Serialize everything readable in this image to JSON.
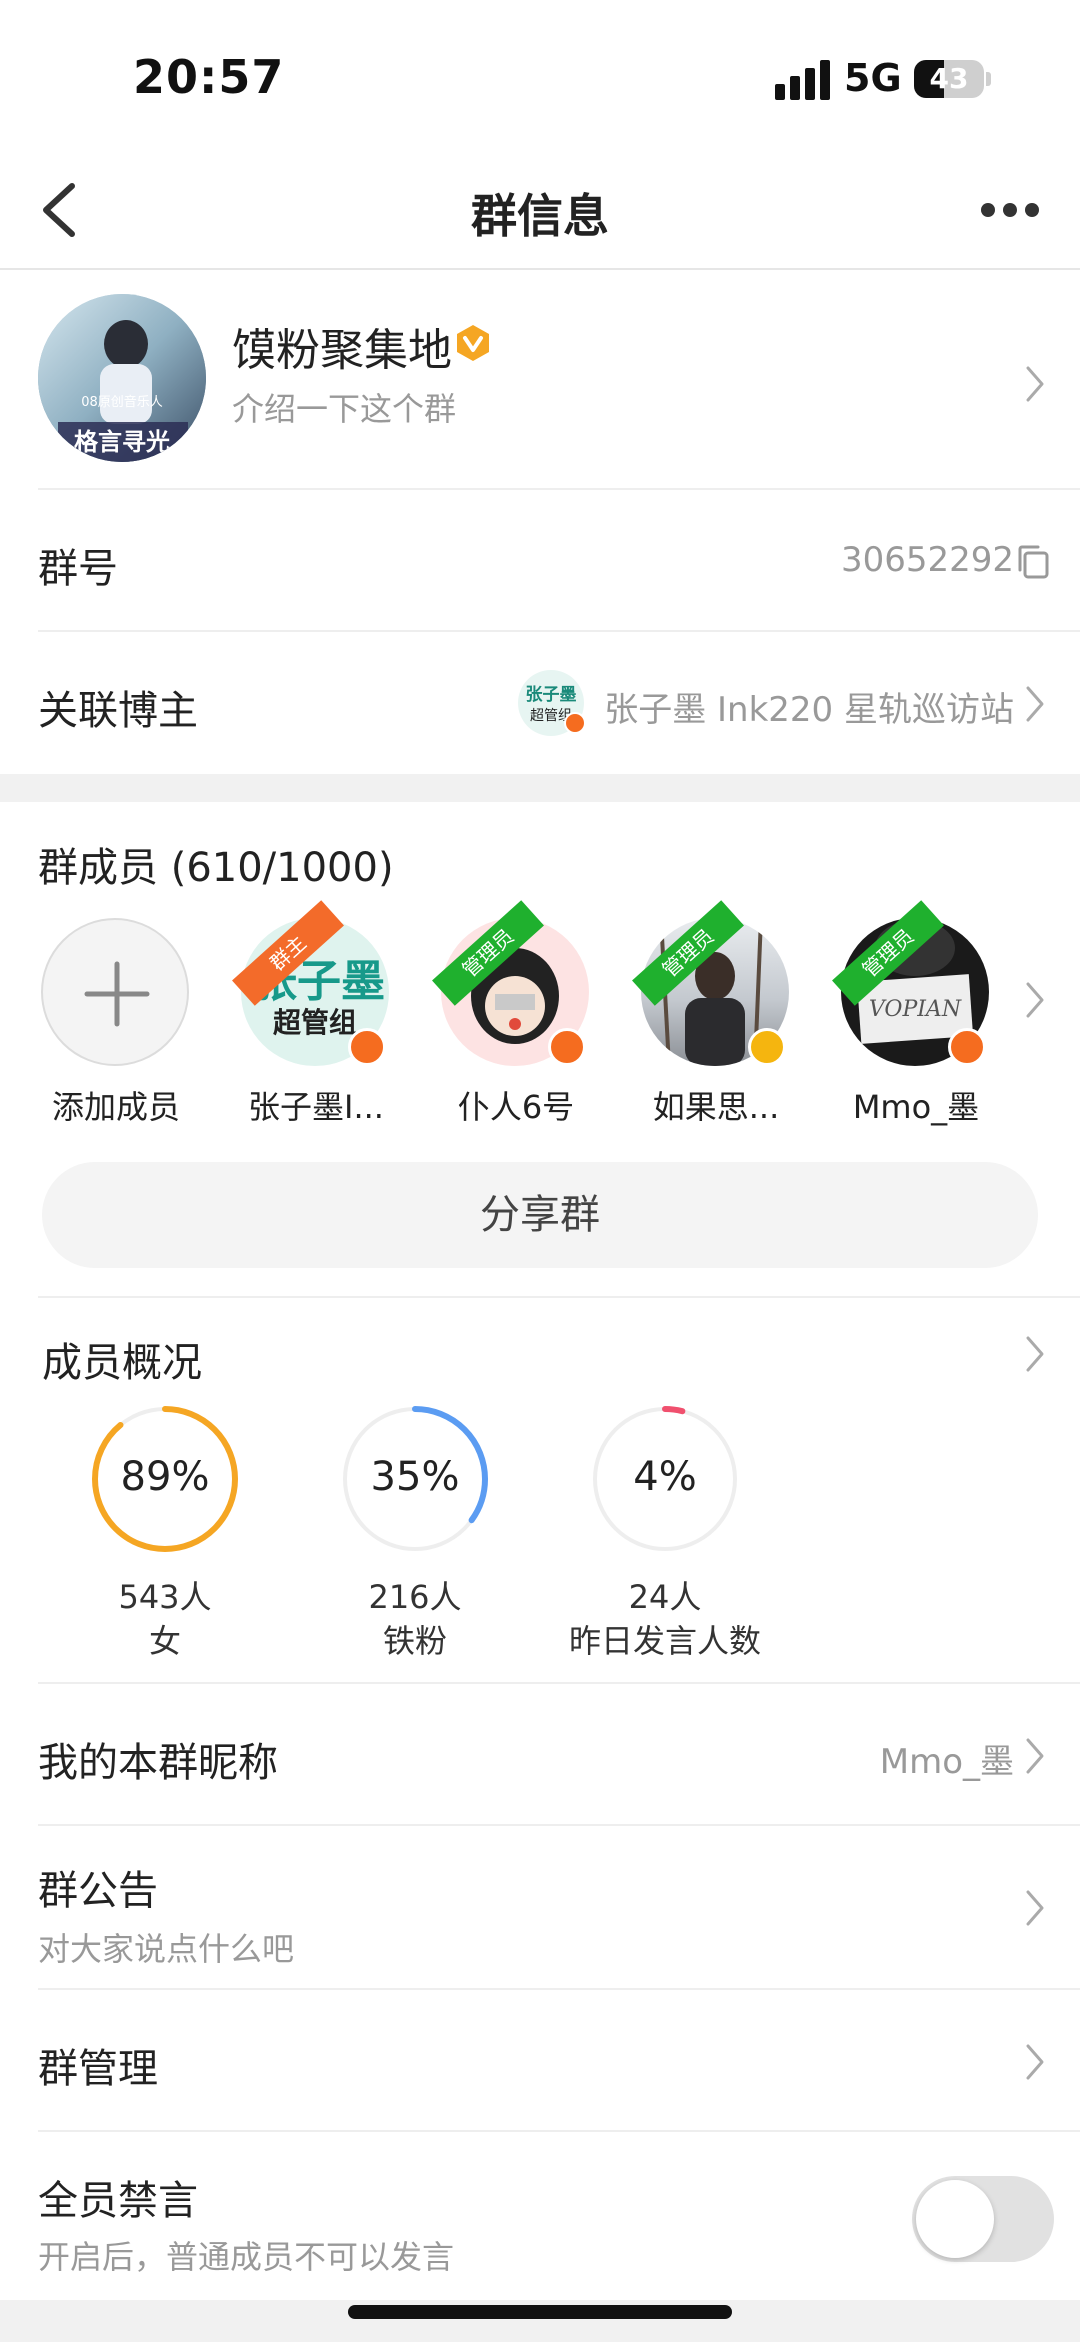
{
  "status_bar": {
    "time": "20:57",
    "network": "5G",
    "battery": "43",
    "battery_level_percent": 43
  },
  "nav": {
    "title": "群信息",
    "back_icon": "chevron-left-icon",
    "more_icon": "more-dots-icon"
  },
  "group": {
    "name": "馍粉聚集地",
    "intro": "介绍一下这个群",
    "avatar_text_1": "08原创音乐人",
    "avatar_text_2": "格言寻光"
  },
  "group_number": {
    "label": "群号",
    "value": "30652292",
    "copy_icon": "copy-icon"
  },
  "linked_blogger": {
    "label": "关联博主",
    "value": "张子墨 Ink220 星轨巡访站",
    "avatar_text_1": "张子墨",
    "avatar_text_2": "超管组"
  },
  "members": {
    "title": "群成员 (610/1000)",
    "items": [
      {
        "name": "添加成员",
        "type": "add"
      },
      {
        "name": "张子墨I...",
        "role": "群主",
        "role_color": "#f36b2a",
        "badge_color": "#f56c1f",
        "avatar_text_1": "张子墨",
        "avatar_text_2": "超管组"
      },
      {
        "name": "仆人6号",
        "role": "管理员",
        "role_color": "#1fb02e",
        "badge_color": "#f56c1f"
      },
      {
        "name": "如果思...",
        "role": "管理员",
        "role_color": "#1fb02e",
        "badge_color": "#f5b50f"
      },
      {
        "name": "Mmo_墨",
        "role": "管理员",
        "role_color": "#1fb02e",
        "badge_color": "#f56c1f",
        "avatar_text_1": "VOPIAN"
      }
    ],
    "share_label": "分享群"
  },
  "overview": {
    "title": "成员概况",
    "stats": [
      {
        "percent_text": "89%",
        "percent": 89,
        "count": "543人",
        "label": "女",
        "color": "#f5a623"
      },
      {
        "percent_text": "35%",
        "percent": 35,
        "count": "216人",
        "label": "铁粉",
        "color": "#5b9cf2"
      },
      {
        "percent_text": "4%",
        "percent": 4,
        "count": "24人",
        "label": "昨日发言人数",
        "color": "#f0506e"
      }
    ]
  },
  "nickname": {
    "label": "我的本群昵称",
    "value": "Mmo_墨"
  },
  "announcement": {
    "label": "群公告",
    "sub": "对大家说点什么吧"
  },
  "management": {
    "label": "群管理"
  },
  "mute_all": {
    "label": "全员禁言",
    "sub": "开启后，普通成员不可以发言",
    "enabled": false
  }
}
